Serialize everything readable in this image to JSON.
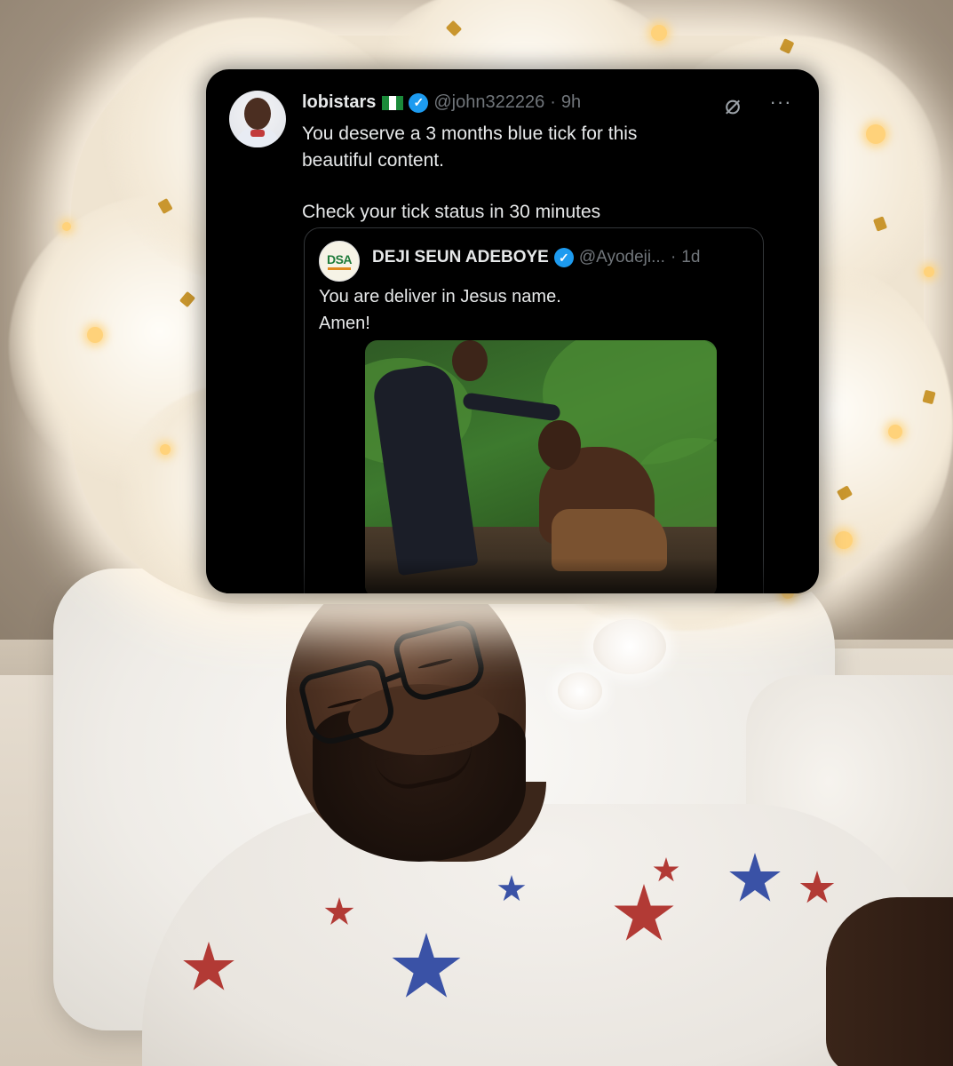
{
  "tweet": {
    "author": {
      "display_name": "lobistars",
      "flag": "NG flag",
      "verified": true,
      "handle": "@john322226",
      "time": "9h"
    },
    "text_lines": [
      "You deserve a 3 months blue tick for this",
      "beautiful content."
    ],
    "text_line_2": "Check your tick status in 30 minutes",
    "icons": {
      "grok": "grok-icon",
      "more": "more-icon"
    },
    "more_glyph": "···",
    "grok_glyph": "⌀",
    "quote": {
      "avatar_text": "DSA",
      "display_name": "DEJI SEUN ADEBOYE",
      "verified": true,
      "handle": "@Ayodeji...",
      "time": "1d",
      "text_lines": [
        "You are deliver in Jesus name.",
        "Amen!"
      ]
    }
  },
  "colors": {
    "tweet_bg": "#000000",
    "verified_blue": "#1d9bf0",
    "muted_text": "#71767b",
    "primary_text": "#e7e9ea"
  }
}
